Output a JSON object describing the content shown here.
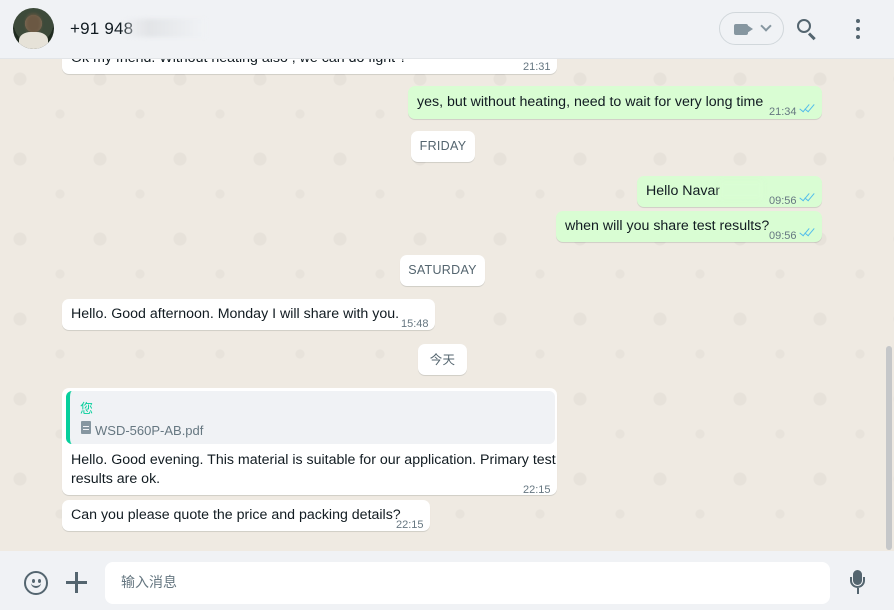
{
  "header": {
    "contact_name": "+91 948",
    "video_icon": "video-camera-icon",
    "search_icon": "search-icon",
    "menu_icon": "vertical-dots-icon"
  },
  "messages": [
    {
      "id": "m1",
      "direction": "in",
      "text": "Ok my friend. Without heating also , we can do fight ?",
      "time": "21:31"
    },
    {
      "id": "m2",
      "direction": "out",
      "text": "yes, but without heating, need to wait for very long time",
      "time": "21:34",
      "status": "read"
    },
    {
      "id": "m3",
      "direction": "out",
      "text": "Hello Navar",
      "time": "09:56",
      "status": "read"
    },
    {
      "id": "m4",
      "direction": "out",
      "text": "when will you share test results?",
      "time": "09:56",
      "status": "read"
    },
    {
      "id": "m5",
      "direction": "in",
      "text": "Hello. Good afternoon. Monday I will share with you.",
      "time": "15:48"
    },
    {
      "id": "m6",
      "direction": "in",
      "quote": {
        "author": "您",
        "file_name": "WSD-560P-AB.pdf",
        "file_icon": "document-icon"
      },
      "text_line1": "Hello. Good evening. This material is suitable for our application. Primary test",
      "text_line2": "results are ok.",
      "time": "22:15"
    },
    {
      "id": "m7",
      "direction": "in",
      "text": "Can you please quote the price and packing details?",
      "time": "22:15"
    }
  ],
  "date_dividers": {
    "friday": "FRIDAY",
    "saturday": "SATURDAY",
    "today": "今天"
  },
  "footer": {
    "input_placeholder": "输入消息",
    "input_value": "",
    "emoji_icon": "emoji-icon",
    "attach_icon": "plus-icon",
    "mic_icon": "microphone-icon"
  },
  "colors": {
    "chat_background": "#efeae2",
    "outgoing_bubble": "#d9fdd3",
    "incoming_bubble": "#ffffff",
    "read_ticks": "#53bdeb",
    "quote_accent": "#06cf9c"
  }
}
